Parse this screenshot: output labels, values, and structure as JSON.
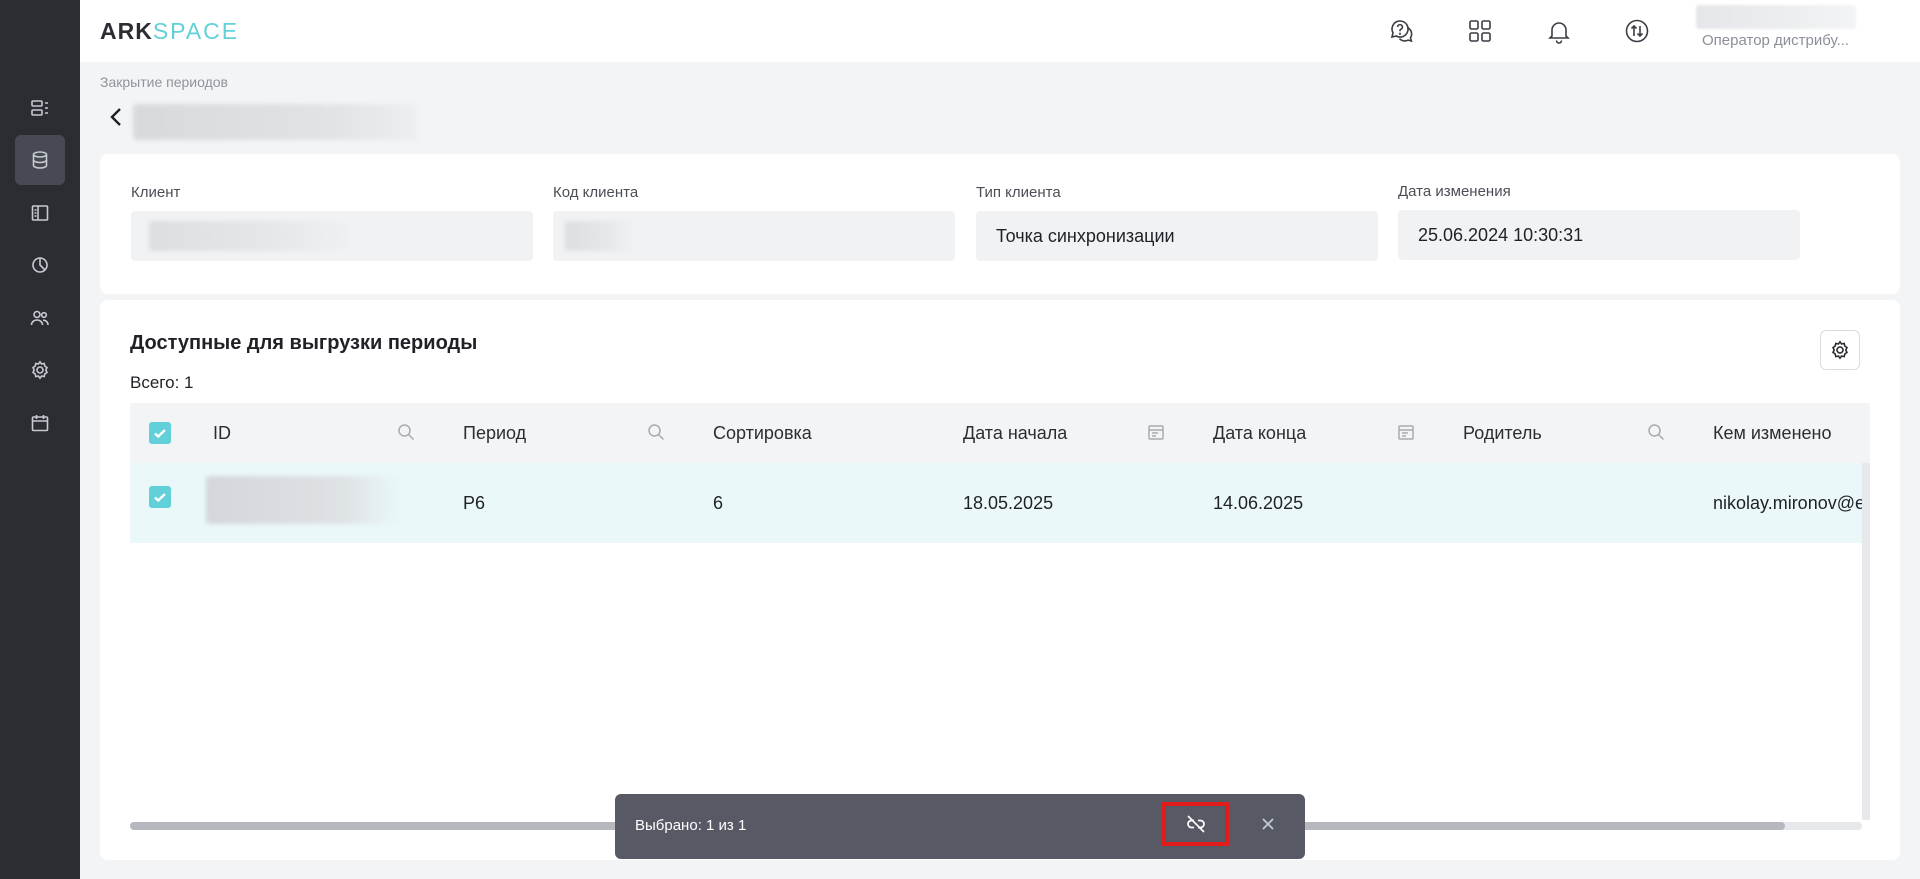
{
  "header": {
    "logo_ark": "ARK",
    "logo_space": "SPACE",
    "user_role": "Оператор дистрибу..."
  },
  "breadcrumb": "Закрытие периодов",
  "info": {
    "client_label": "Клиент",
    "client_code_label": "Код клиента",
    "client_type_label": "Тип клиента",
    "client_type_value": "Точка синхронизации",
    "modified_label": "Дата изменения",
    "modified_value": "25.06.2024 10:30:31"
  },
  "table": {
    "title": "Доступные для выгрузки периоды",
    "total": "Всего: 1",
    "columns": [
      "ID",
      "Период",
      "Сортировка",
      "Дата начала",
      "Дата конца",
      "Родитель",
      "Кем изменено"
    ],
    "rows": [
      {
        "id": "",
        "period": "P6",
        "sort": "6",
        "start": "18.05.2025",
        "end": "14.06.2025",
        "parent": "",
        "changed_by": "nikolay.mironov@et"
      }
    ],
    "row_selected": true
  },
  "selection_bar": {
    "text": "Выбрано: 1 из 1"
  },
  "colors": {
    "accent": "#62d0d8",
    "sidebar": "#2b2d33",
    "highlight_border": "#e21b1b"
  }
}
